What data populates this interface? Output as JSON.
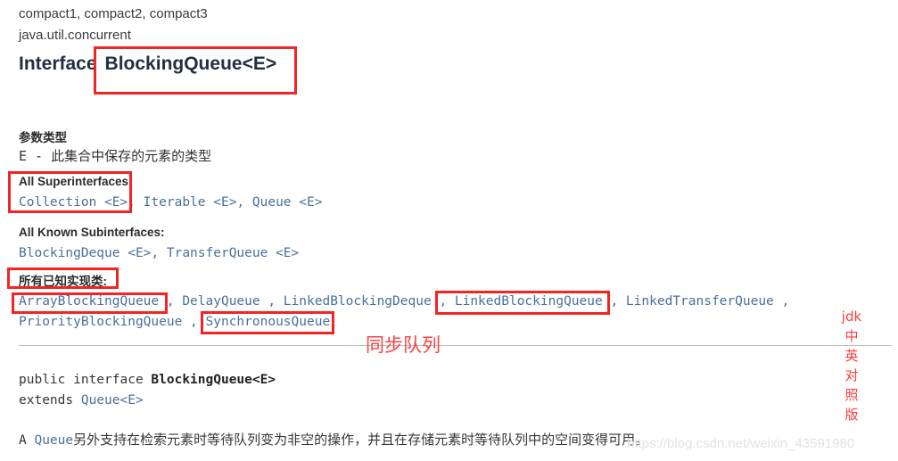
{
  "page": {
    "breadcrumb_modules": "compact1, compact2, compact3",
    "package": "java.util.concurrent",
    "title_keyword": "Interface",
    "title_name": "BlockingQueue<E>"
  },
  "type_parameters": {
    "label": "参数类型",
    "entry": "E - 此集合中保存的元素的类型"
  },
  "superinterfaces": {
    "label": "All Superinterfaces:",
    "items": [
      "Collection <E>",
      "Iterable <E>",
      "Queue <E>"
    ],
    "separator": ",",
    "raw": "Collection <E>,  Iterable <E>,  Queue <E>"
  },
  "subinterfaces": {
    "label": "All Known Subinterfaces:",
    "items": [
      "BlockingDeque <E>",
      "TransferQueue <E>"
    ],
    "raw": "BlockingDeque <E>,  TransferQueue <E>"
  },
  "implementing_classes": {
    "label": "所有已知实现类:",
    "line1": "ArrayBlockingQueue ,  DelayQueue ,  LinkedBlockingDeque ,  LinkedBlockingQueue ,  LinkedTransferQueue ,",
    "line2": "PriorityBlockingQueue ,  SynchronousQueue",
    "items": [
      "ArrayBlockingQueue",
      "DelayQueue",
      "LinkedBlockingDeque",
      "LinkedBlockingQueue",
      "LinkedTransferQueue",
      "PriorityBlockingQueue",
      "SynchronousQueue"
    ]
  },
  "signature": {
    "line1_prefix": "public interface ",
    "line1_name": "BlockingQueue<E>",
    "line2_prefix": "extends ",
    "line2_type": "Queue<E>"
  },
  "description": {
    "prefix": "A ",
    "link": "Queue",
    "text": "另外支持在检索元素时等待队列变为非空的操作，并且在存储元素时等待队列中的空间变得可用。"
  },
  "annotations": {
    "sync_queue_note": "同步队列",
    "vertical_label_chars": [
      "jdk",
      "中",
      "英",
      "对",
      "照",
      "版"
    ],
    "box_color": "#f22424",
    "note_color": "#fa4343"
  },
  "watermark": {
    "url": "https://blog.csdn.net/weixin_43591980"
  }
}
